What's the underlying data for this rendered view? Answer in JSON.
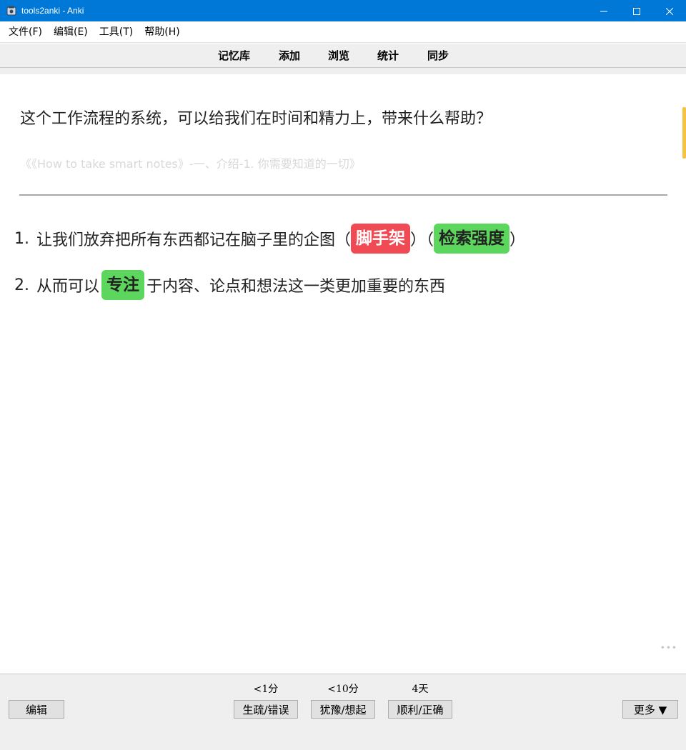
{
  "window": {
    "title": "tools2anki - Anki"
  },
  "menu": [
    {
      "label": "文件(F)"
    },
    {
      "label": "编辑(E)"
    },
    {
      "label": "工具(T)"
    },
    {
      "label": "帮助(H)"
    }
  ],
  "toolbar": {
    "decks": "记忆库",
    "add": "添加",
    "browse": "浏览",
    "stats": "统计",
    "sync": "同步"
  },
  "card": {
    "question": "这个工作流程的系统，可以给我们在时间和精力上，带来什么帮助？",
    "source": "《《How to take smart notes》-一、介绍-1. 你需要知道的一切》",
    "answers": [
      {
        "number": "1.",
        "text_before": "让我们放弃把所有东西都记在脑子里的企图（",
        "cloze1": "脚手架",
        "text_mid": "）（",
        "cloze2": "检索强度",
        "text_after": "）"
      },
      {
        "number": "2.",
        "text_before": "从而可以",
        "cloze1": "专注",
        "text_after": "于内容、论点和想法这一类更加重要的东西"
      }
    ]
  },
  "review": {
    "edit": "编辑",
    "more": "更多 ▼",
    "again_time": "<1分",
    "again": "生疏/错误",
    "hard_time": "<10分",
    "hard": "犹豫/想起",
    "good_time": "4天",
    "good": "顺利/正确"
  },
  "colors": {
    "titlebar": "#0078d7",
    "cloze_red": "#f04a55",
    "cloze_green": "#5cd65c",
    "accent": "#f5c242"
  },
  "icons": {
    "app": "anki-icon",
    "minimize": "minimize-icon",
    "maximize": "maximize-icon",
    "close": "close-icon"
  }
}
